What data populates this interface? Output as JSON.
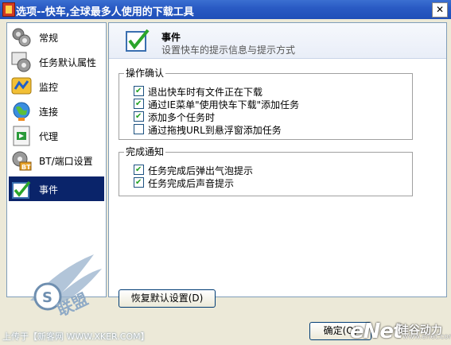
{
  "window": {
    "title": "选项--快车,全球最多人使用的下载工具",
    "close_glyph": "✕"
  },
  "sidebar": {
    "items": [
      {
        "label": "常规",
        "icon": "settings-gears-icon",
        "selected": false
      },
      {
        "label": "任务默认属性",
        "icon": "task-gears-icon",
        "selected": false
      },
      {
        "label": "监控",
        "icon": "monitor-icon",
        "selected": false
      },
      {
        "label": "连接",
        "icon": "globe-connection-icon",
        "selected": false
      },
      {
        "label": "代理",
        "icon": "proxy-icon",
        "selected": false
      },
      {
        "label": "BT/端口设置",
        "icon": "bt-gear-icon",
        "selected": false
      },
      {
        "label": "事件",
        "icon": "event-checkbox-icon",
        "selected": true
      }
    ]
  },
  "header": {
    "title": "事件",
    "subtitle": "设置快车的提示信息与提示方式",
    "icon": "event-checkbox-icon"
  },
  "groups": {
    "confirm": {
      "title": "操作确认",
      "options": [
        {
          "label": "退出快车时有文件正在下载",
          "checked": true
        },
        {
          "label": "通过IE菜单\"使用快车下载\"添加任务",
          "checked": true
        },
        {
          "label": "添加多个任务时",
          "checked": true
        },
        {
          "label": "通过拖拽URL到悬浮窗添加任务",
          "checked": false
        }
      ]
    },
    "notify": {
      "title": "完成通知",
      "options": [
        {
          "label": "任务完成后弹出气泡提示",
          "checked": true
        },
        {
          "label": "任务完成后声音提示",
          "checked": true
        }
      ]
    }
  },
  "buttons": {
    "restore_default": "恢复默认设置(D)",
    "ok": "确定(O)"
  },
  "overlay": {
    "upload_credit": "上传于【新客网 WWW.XKER.COM】",
    "logo_text": "联盟",
    "enet_logo": "eNet",
    "enet_sub": "硅谷动力",
    "enet_url": "www.enet.com.cn"
  },
  "colors": {
    "title_bar": "#2a5bc4",
    "selection": "#0a246a",
    "check_mark": "#21a121"
  }
}
